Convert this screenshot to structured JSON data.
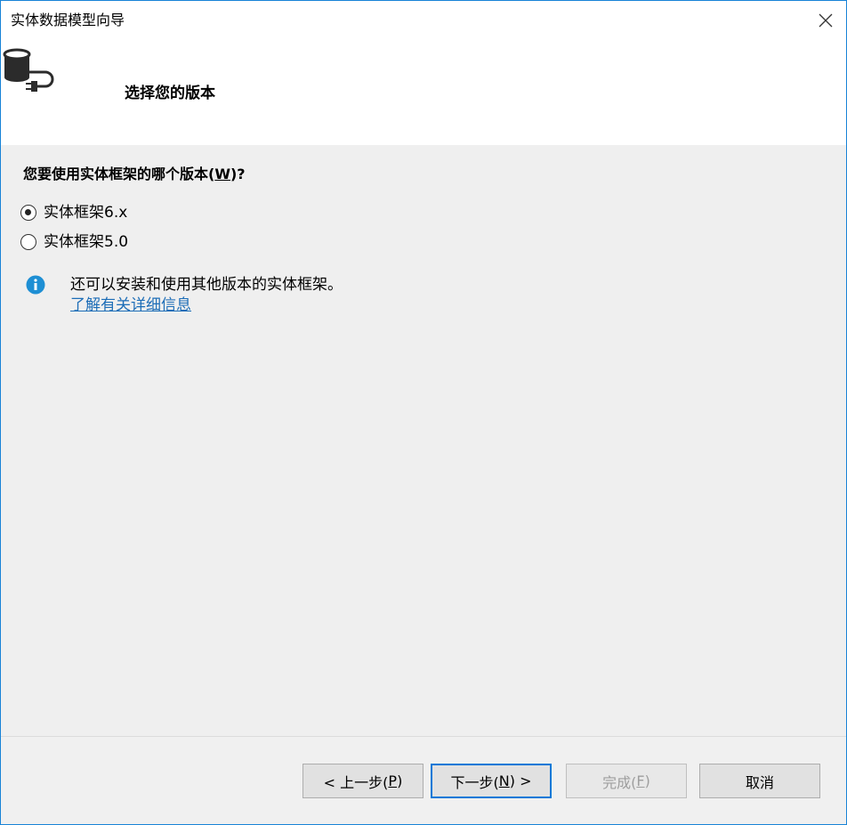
{
  "window": {
    "title": "实体数据模型向导"
  },
  "header": {
    "heading": "选择您的版本",
    "icon": "database-plug-icon"
  },
  "content": {
    "question_prefix": "您要使用实体框架的哪个版本(",
    "question_mnemonic": "W",
    "question_suffix": ")?",
    "options": [
      {
        "label": "实体框架6.x",
        "checked": true
      },
      {
        "label": "实体框架5.0",
        "checked": false
      }
    ],
    "info": {
      "icon": "info-icon",
      "text": "还可以安装和使用其他版本的实体框架。",
      "link": "了解有关详细信息"
    }
  },
  "footer": {
    "back": {
      "prefix": "< 上一步(",
      "mnemonic": "P",
      "suffix": ")"
    },
    "next": {
      "prefix": "下一步(",
      "mnemonic": "N",
      "suffix": ") >"
    },
    "finish": {
      "prefix": "完成(",
      "mnemonic": "F",
      "suffix": ")",
      "disabled": true
    },
    "cancel": {
      "label": "取消"
    }
  },
  "colors": {
    "accent": "#0078d7",
    "link": "#1c6db7",
    "info_icon": "#1e8fd4",
    "content_bg": "#efefef"
  }
}
